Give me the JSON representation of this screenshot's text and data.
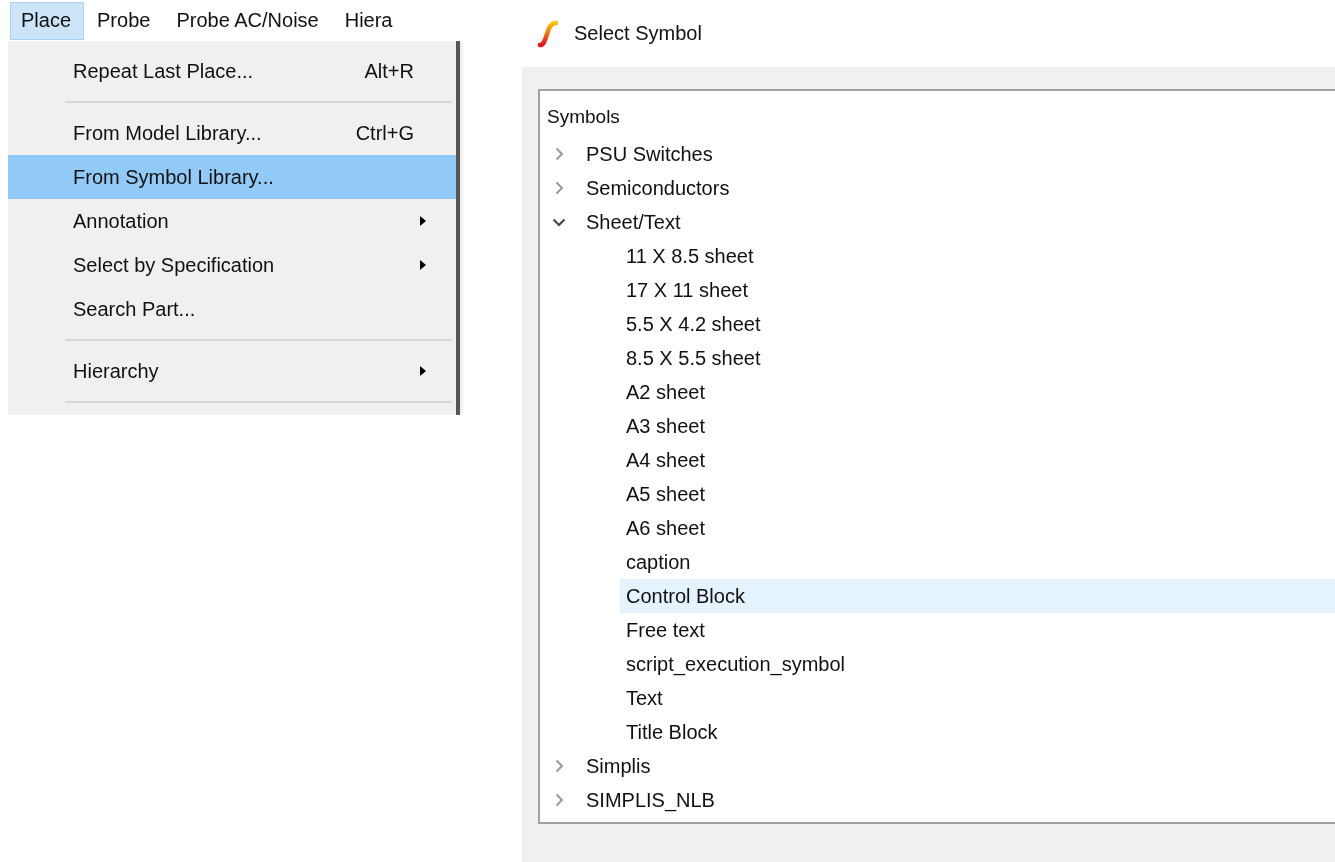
{
  "menu_bar": {
    "items": [
      {
        "label": "Place",
        "selected": true
      },
      {
        "label": "Probe",
        "selected": false
      },
      {
        "label": "Probe AC/Noise",
        "selected": false
      },
      {
        "label": "Hiera",
        "selected": false
      }
    ]
  },
  "menu": {
    "items": [
      {
        "kind": "item",
        "label": "Repeat Last Place...",
        "shortcut": "Alt+R",
        "submenu": false,
        "selected": false
      },
      {
        "kind": "separator"
      },
      {
        "kind": "item",
        "label": "From Model Library...",
        "shortcut": "Ctrl+G",
        "submenu": false,
        "selected": false
      },
      {
        "kind": "item",
        "label": "From Symbol Library...",
        "submenu": false,
        "selected": true
      },
      {
        "kind": "item",
        "label": "Annotation",
        "submenu": true,
        "selected": false
      },
      {
        "kind": "item",
        "label": "Select by Specification",
        "submenu": true,
        "selected": false
      },
      {
        "kind": "item",
        "label": "Search Part...",
        "submenu": false,
        "selected": false
      },
      {
        "kind": "separator"
      },
      {
        "kind": "item",
        "label": "Hierarchy",
        "submenu": true,
        "selected": false
      },
      {
        "kind": "separator"
      }
    ]
  },
  "dialog": {
    "title": "Select Symbol",
    "tree": {
      "header": "Symbols",
      "items": [
        {
          "label": "PSU Switches",
          "expanded": false,
          "selected": false
        },
        {
          "label": "Semiconductors",
          "expanded": false,
          "selected": false
        },
        {
          "label": "Sheet/Text",
          "expanded": true,
          "selected": false,
          "children": [
            {
              "label": "11 X 8.5 sheet",
              "selected": false
            },
            {
              "label": "17 X 11 sheet",
              "selected": false
            },
            {
              "label": "5.5 X 4.2 sheet",
              "selected": false
            },
            {
              "label": "8.5 X 5.5 sheet",
              "selected": false
            },
            {
              "label": "A2 sheet",
              "selected": false
            },
            {
              "label": "A3 sheet",
              "selected": false
            },
            {
              "label": "A4 sheet",
              "selected": false
            },
            {
              "label": "A5 sheet",
              "selected": false
            },
            {
              "label": "A6 sheet",
              "selected": false
            },
            {
              "label": "caption",
              "selected": false
            },
            {
              "label": "Control Block",
              "selected": true
            },
            {
              "label": "Free text",
              "selected": false
            },
            {
              "label": "script_execution_symbol",
              "selected": false
            },
            {
              "label": "Text",
              "selected": false
            },
            {
              "label": "Title Block",
              "selected": false
            }
          ]
        },
        {
          "label": "Simplis",
          "expanded": false,
          "selected": false
        },
        {
          "label": "SIMPLIS_NLB",
          "expanded": false,
          "selected": false
        }
      ]
    }
  }
}
